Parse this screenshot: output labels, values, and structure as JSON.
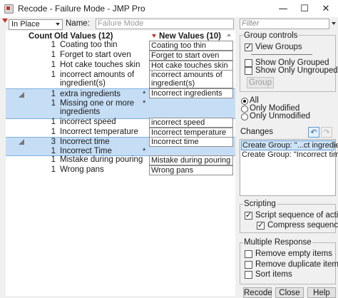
{
  "window": {
    "title": "Recode - Failure Mode - JMP Pro",
    "minimize": "—",
    "maximize": "☐",
    "close": "✕"
  },
  "toolbar": {
    "mode_value": "In Place",
    "name_label": "Name:",
    "name_value": "Failure Mode"
  },
  "table": {
    "count_header": "Count",
    "old_header": "Old Values (12)",
    "new_header": "New Values (10)",
    "rows": [
      {
        "count": "1",
        "old": "Coating too thin",
        "new": "Coating too thin"
      },
      {
        "count": "1",
        "old": "Forget to start oven",
        "new": "Forget to start oven"
      },
      {
        "count": "1",
        "old": "Hot cake touches skin",
        "new": "Hot cake touches skin"
      },
      {
        "count": "1",
        "old": "incorrect amounts of ingredient(s)",
        "new": "incorrect amounts of ingredient(s)"
      },
      {
        "count": "1",
        "old": "extra ingredients",
        "star": "*",
        "new": "Incorrect ingredients"
      },
      {
        "count": "1",
        "old": "Missing one or more ingredients",
        "star": "*",
        "new": ""
      },
      {
        "count": "1",
        "old": "incorrect speed",
        "new": "incorrect speed"
      },
      {
        "count": "1",
        "old": "Incorrect temperature",
        "new": "Incorrect temperature"
      },
      {
        "count": "3",
        "old": "Incorrect time",
        "new": "Incorrect time"
      },
      {
        "count": "1",
        "old": "Incorrect Time",
        "star": "*",
        "new": ""
      },
      {
        "count": "1",
        "old": "Mistake during pouring",
        "new": "Mistake during pouring"
      },
      {
        "count": "1",
        "old": "Wrong pans",
        "new": "Wrong pans"
      }
    ]
  },
  "filter": {
    "placeholder": "Filter"
  },
  "group_controls": {
    "title": "Group controls",
    "view_groups": "View Groups",
    "show_only_grouped": "Show Only Grouped",
    "show_only_ungrouped": "Show Only Ungrouped",
    "group_button": "Group"
  },
  "view_filter": {
    "all": "All",
    "only_modified": "Only Modified",
    "only_unmodified": "Only Unmodified"
  },
  "changes": {
    "title": "Changes",
    "items": [
      "Create Group: \"...ct ingredients\"",
      "Create Group: \"Incorrect time\""
    ]
  },
  "scripting": {
    "title": "Scripting",
    "script_sequence": "Script sequence of actions",
    "compress_sequence": "Compress sequence"
  },
  "multiple_response": {
    "title": "Multiple Response",
    "remove_empty": "Remove empty items",
    "remove_duplicate": "Remove duplicate items",
    "sort_items": "Sort items"
  },
  "buttons": {
    "recode": "Recode",
    "close": "Close",
    "help": "Help"
  },
  "colors": {
    "group_row": "#c6def5",
    "accent_red": "#c0392b",
    "selection": "#cfe4f7"
  }
}
